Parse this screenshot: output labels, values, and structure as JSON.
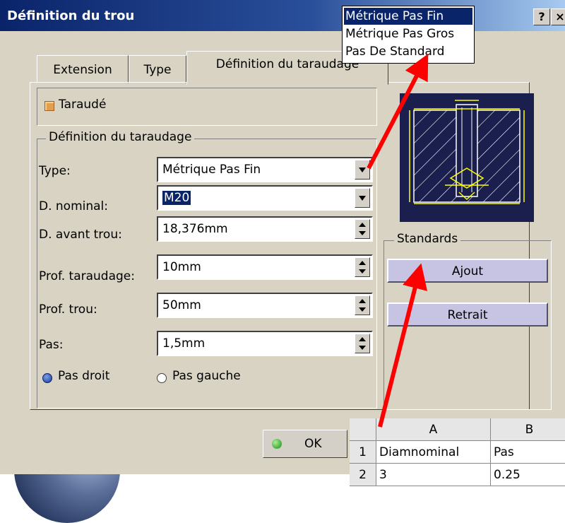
{
  "window": {
    "title": "Définition du trou",
    "help_label": "?",
    "close_label": "×"
  },
  "tabs": [
    {
      "label": "Extension",
      "active": false
    },
    {
      "label": "Type",
      "active": false
    },
    {
      "label": "Définition du taraudage",
      "active": true
    }
  ],
  "tapped": {
    "label": "Taraudé",
    "checked": true
  },
  "thread_group": {
    "title": "Définition du taraudage",
    "rows": [
      {
        "label": "Type:",
        "value": "Métrique Pas Fin",
        "control": "combo"
      },
      {
        "label": "D. nominal:",
        "value": "M20",
        "control": "combo"
      },
      {
        "label": "D. avant trou:",
        "value": "18,376mm",
        "control": "spinner"
      },
      {
        "label": "Prof. taraudage:",
        "value": "10mm",
        "control": "spinner"
      },
      {
        "label": "Prof. trou:",
        "value": "50mm",
        "control": "spinner"
      },
      {
        "label": "Pas:",
        "value": "1,5mm",
        "control": "spinner"
      }
    ],
    "direction": {
      "right_label": "Pas droit",
      "left_label": "Pas gauche",
      "selected": "Pas droit"
    }
  },
  "standards": {
    "title": "Standards",
    "add_label": "Ajout",
    "remove_label": "Retrait"
  },
  "ok_label": "OK",
  "type_dropdown": {
    "options": [
      "Métrique Pas Fin",
      "Métrique Pas Gros",
      "Pas De Standard"
    ],
    "highlighted": "Métrique Pas Fin"
  },
  "spreadsheet": {
    "columns": [
      "A",
      "B"
    ],
    "rows": [
      {
        "num": "1",
        "a": "Diamnominal",
        "b": "Pas"
      },
      {
        "num": "2",
        "a": "3",
        "b": "0.25"
      }
    ]
  },
  "colors": {
    "title_bar": "#0a246a",
    "dialog_bg": "#d8d3c2",
    "button_bg": "#c6c4e2",
    "annotation_arrow": "#ff0000",
    "drawing_lines": "#ffff00"
  }
}
